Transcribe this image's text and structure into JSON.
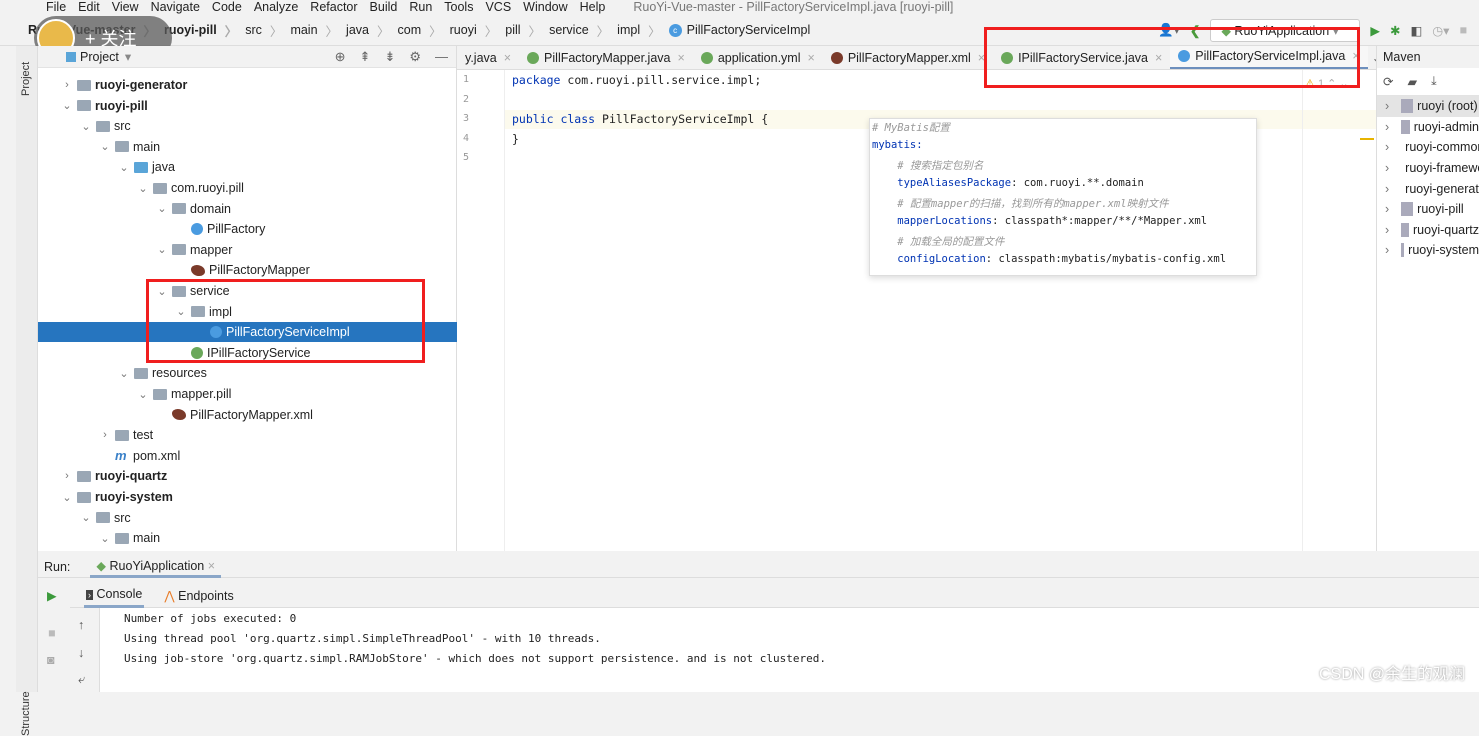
{
  "menu": [
    "File",
    "Edit",
    "View",
    "Navigate",
    "Code",
    "Analyze",
    "Refactor",
    "Build",
    "Run",
    "Tools",
    "VCS",
    "Window",
    "Help"
  ],
  "window_title": "RuoYi-Vue-master - PillFactoryServiceImpl.java [ruoyi-pill]",
  "breadcrumb": [
    "RuoYi-Vue-master",
    "ruoyi-pill",
    "src",
    "main",
    "java",
    "com",
    "ruoyi",
    "pill",
    "service",
    "impl",
    "PillFactoryServiceImpl"
  ],
  "follow_badge": "+ 关注",
  "run_config": "RuoYiApplication",
  "project_panel": {
    "title": "Project",
    "side_label": "Project"
  },
  "tree": [
    {
      "label": "ruoyi-generator",
      "level": 0,
      "state": "collapsed",
      "icon": "module",
      "bold": true
    },
    {
      "label": "ruoyi-pill",
      "level": 0,
      "state": "expanded",
      "icon": "module",
      "bold": true
    },
    {
      "label": "src",
      "level": 1,
      "state": "expanded",
      "icon": "folder"
    },
    {
      "label": "main",
      "level": 2,
      "state": "expanded",
      "icon": "folder"
    },
    {
      "label": "java",
      "level": 3,
      "state": "expanded",
      "icon": "source-folder"
    },
    {
      "label": "com.ruoyi.pill",
      "level": 4,
      "state": "expanded",
      "icon": "package"
    },
    {
      "label": "domain",
      "level": 5,
      "state": "expanded",
      "icon": "package"
    },
    {
      "label": "PillFactory",
      "level": 6,
      "state": "leaf",
      "icon": "class"
    },
    {
      "label": "mapper",
      "level": 5,
      "state": "expanded",
      "icon": "package"
    },
    {
      "label": "PillFactoryMapper",
      "level": 6,
      "state": "leaf",
      "icon": "mybatis"
    },
    {
      "label": "service",
      "level": 5,
      "state": "expanded",
      "icon": "package"
    },
    {
      "label": "impl",
      "level": 6,
      "state": "expanded",
      "icon": "package"
    },
    {
      "label": "PillFactoryServiceImpl",
      "level": 7,
      "state": "leaf",
      "icon": "class",
      "selected": true
    },
    {
      "label": "IPillFactoryService",
      "level": 6,
      "state": "leaf",
      "icon": "interface"
    },
    {
      "label": "resources",
      "level": 3,
      "state": "expanded",
      "icon": "folder"
    },
    {
      "label": "mapper.pill",
      "level": 4,
      "state": "expanded",
      "icon": "folder"
    },
    {
      "label": "PillFactoryMapper.xml",
      "level": 5,
      "state": "leaf",
      "icon": "mybatis"
    },
    {
      "label": "test",
      "level": 2,
      "state": "collapsed",
      "icon": "folder"
    },
    {
      "label": "pom.xml",
      "level": 2,
      "state": "leaf",
      "icon": "maven"
    },
    {
      "label": "ruoyi-quartz",
      "level": 0,
      "state": "collapsed",
      "icon": "module",
      "bold": true
    },
    {
      "label": "ruoyi-system",
      "level": 0,
      "state": "expanded",
      "icon": "module",
      "bold": true
    },
    {
      "label": "src",
      "level": 1,
      "state": "expanded",
      "icon": "folder"
    },
    {
      "label": "main",
      "level": 2,
      "state": "expanded",
      "icon": "folder"
    }
  ],
  "tabs": [
    {
      "label": "y.java",
      "icon": "none"
    },
    {
      "label": "PillFactoryMapper.java",
      "icon": "interface"
    },
    {
      "label": "application.yml",
      "icon": "spring"
    },
    {
      "label": "PillFactoryMapper.xml",
      "icon": "mybatis"
    },
    {
      "label": "IPillFactoryService.java",
      "icon": "interface"
    },
    {
      "label": "PillFactoryServiceImpl.java",
      "icon": "class",
      "active": true
    }
  ],
  "editor": {
    "line_numbers": [
      "1",
      "2",
      "3",
      "4",
      "5"
    ],
    "code": {
      "l1_kw": "package",
      "l1_rest": " com.ruoyi.pill.service.impl;",
      "l3_kw": "public class",
      "l3_rest": " PillFactoryServiceImpl {",
      "l4": "}"
    },
    "warnings": "1"
  },
  "popup": [
    {
      "text": "# MyBatis配置",
      "type": "comment"
    },
    {
      "text": "mybatis:",
      "type": "key"
    },
    {
      "text": "    # 搜索指定包别名",
      "type": "comment"
    },
    {
      "key": "    typeAliasesPackage",
      "value": ": com.ruoyi.**.domain"
    },
    {
      "text": "    # 配置mapper的扫描，找到所有的mapper.xml映射文件",
      "type": "comment"
    },
    {
      "key": "    mapperLocations",
      "value": ": classpath*:mapper/**/*Mapper.xml"
    },
    {
      "text": "    # 加载全局的配置文件",
      "type": "comment"
    },
    {
      "key": "    configLocation",
      "value": ": classpath:mybatis/mybatis-config.xml"
    }
  ],
  "maven": {
    "title": "Maven",
    "items": [
      "ruoyi (root)",
      "ruoyi-admin",
      "ruoyi-common",
      "ruoyi-framework",
      "ruoyi-generator",
      "ruoyi-pill",
      "ruoyi-quartz",
      "ruoyi-system"
    ]
  },
  "run": {
    "label": "Run:",
    "tab": "RuoYiApplication",
    "console_tab": "Console",
    "endpoints_tab": "Endpoints",
    "structure_label": "Structure",
    "lines": [
      "Number of jobs executed: 0",
      "Using thread pool 'org.quartz.simpl.SimpleThreadPool' - with 10 threads.",
      "Using job-store 'org.quartz.simpl.RAMJobStore' - which does not support persistence. and is not clustered."
    ]
  },
  "watermark": "CSDN @余生的观澜",
  "colors": {
    "selection": "#2675bf",
    "highlight_box": "#f01e1e",
    "keyword": "#0033b3"
  }
}
